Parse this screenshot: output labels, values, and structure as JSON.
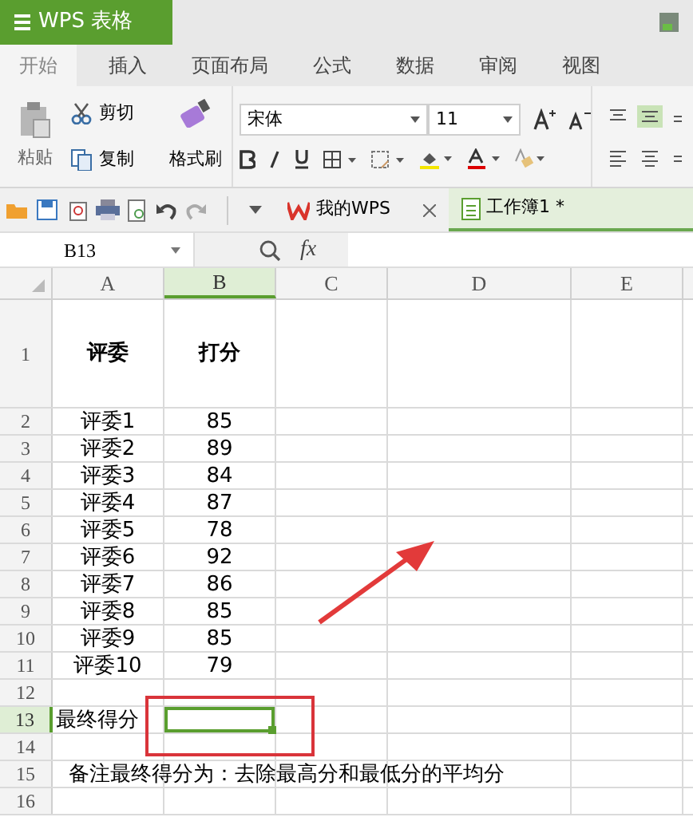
{
  "title_bar": {
    "app_menu": "WPS 表格"
  },
  "ribbon_tabs": [
    {
      "label": "开始",
      "selected": true
    },
    {
      "label": "插入",
      "selected": false
    },
    {
      "label": "页面布局",
      "selected": false
    },
    {
      "label": "公式",
      "selected": false
    },
    {
      "label": "数据",
      "selected": false
    },
    {
      "label": "审阅",
      "selected": false
    },
    {
      "label": "视图",
      "selected": false
    }
  ],
  "ribbon": {
    "paste": "粘贴",
    "cut": "剪切",
    "copy": "复制",
    "format_painter": "格式刷",
    "font": "宋体",
    "font_size": "11"
  },
  "doc_tabs": [
    {
      "label": "我的WPS",
      "selected": false,
      "closable": true
    },
    {
      "label": "工作簿1 *",
      "selected": true,
      "closable": false
    }
  ],
  "formula_bar": {
    "name_box": "B13",
    "fx": "fx"
  },
  "columns": [
    {
      "label": "A",
      "selected": false
    },
    {
      "label": "B",
      "selected": true
    },
    {
      "label": "C",
      "selected": false
    },
    {
      "label": "D",
      "selected": false
    },
    {
      "label": "E",
      "selected": false
    }
  ],
  "rows": [
    {
      "number": "1",
      "selected": false,
      "cells": [
        "评委",
        "打分"
      ]
    },
    {
      "number": "2",
      "selected": false,
      "cells": [
        "评委1",
        "85"
      ]
    },
    {
      "number": "3",
      "selected": false,
      "cells": [
        "评委2",
        "89"
      ]
    },
    {
      "number": "4",
      "selected": false,
      "cells": [
        "评委3",
        "84"
      ]
    },
    {
      "number": "5",
      "selected": false,
      "cells": [
        "评委4",
        "87"
      ]
    },
    {
      "number": "6",
      "selected": false,
      "cells": [
        "评委5",
        "78"
      ]
    },
    {
      "number": "7",
      "selected": false,
      "cells": [
        "评委6",
        "92"
      ]
    },
    {
      "number": "8",
      "selected": false,
      "cells": [
        "评委7",
        "86"
      ]
    },
    {
      "number": "9",
      "selected": false,
      "cells": [
        "评委8",
        "85"
      ]
    },
    {
      "number": "10",
      "selected": false,
      "cells": [
        "评委9",
        "85"
      ]
    },
    {
      "number": "11",
      "selected": false,
      "cells": [
        "评委10",
        "79"
      ]
    },
    {
      "number": "12",
      "selected": false,
      "cells": []
    },
    {
      "number": "13",
      "selected": true,
      "cells": [
        "最终得分"
      ]
    },
    {
      "number": "14",
      "selected": false,
      "cells": []
    },
    {
      "number": "15",
      "selected": false,
      "cells": [
        "备注最终得分为：去除最高分和最低分的平均分"
      ]
    },
    {
      "number": "16",
      "selected": false,
      "cells": []
    }
  ]
}
